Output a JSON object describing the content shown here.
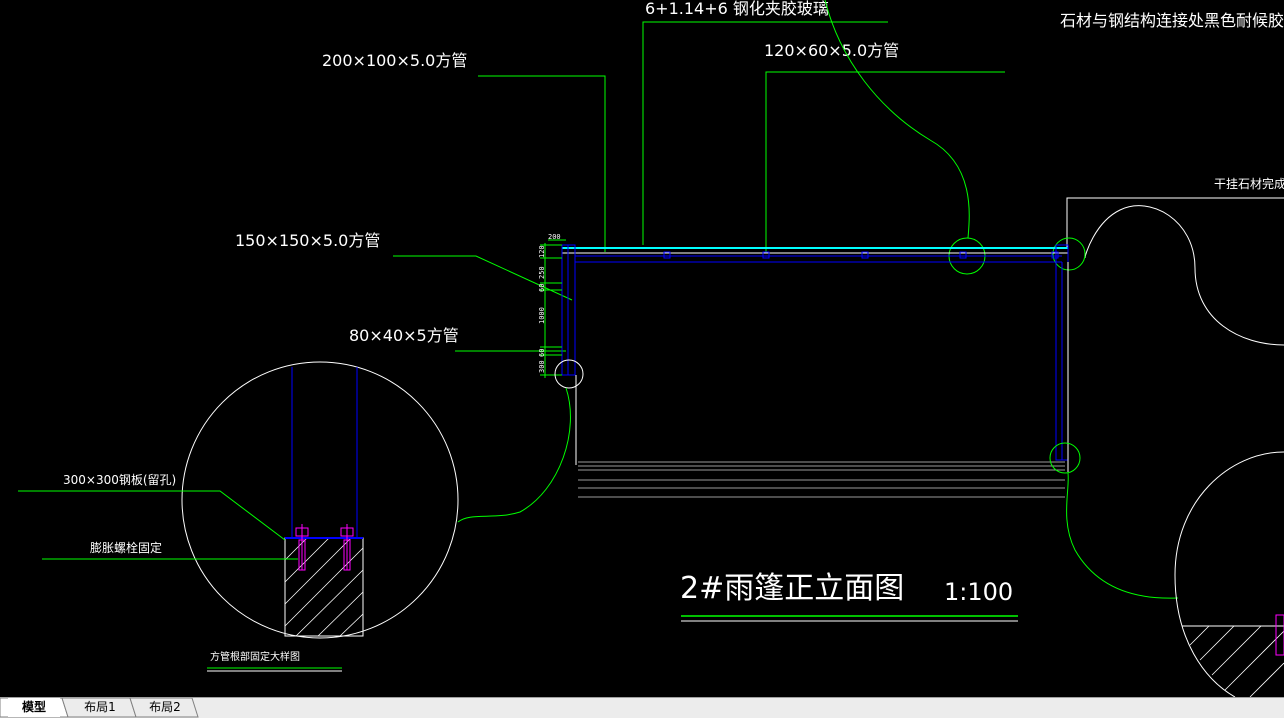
{
  "labels": {
    "glass_top": "6+1.14+6 钢化夹胶玻璃",
    "stone_seal": "石材与钢结构连接处黑色耐候胶密封",
    "tube_200": "200×100×5.0方管",
    "tube_120": "120×60×5.0方管",
    "stone_finish": "干挂石材完成面",
    "tube_150": "150×150×5.0方管",
    "tube_80": "80×40×5方管",
    "steel_plate": "300×300钢板(留孔)",
    "anchor_bolt": "膨胀螺栓固定",
    "detail_title": "方管根部固定大样图",
    "main_title": "2#雨篷正立面图",
    "scale": "1:100"
  },
  "dimensions": [
    "200",
    "120",
    "250",
    "60",
    "1000",
    "300",
    "60"
  ],
  "tabs": [
    {
      "label": "模型",
      "active": true
    },
    {
      "label": "布局1",
      "active": false
    },
    {
      "label": "布局2",
      "active": false
    }
  ],
  "colors": {
    "background": "#000000",
    "structure": "#0000ff",
    "leader": "#00ff00",
    "text": "#ffffff",
    "bolt": "#ff00ff",
    "cyan": "#00ffff"
  }
}
